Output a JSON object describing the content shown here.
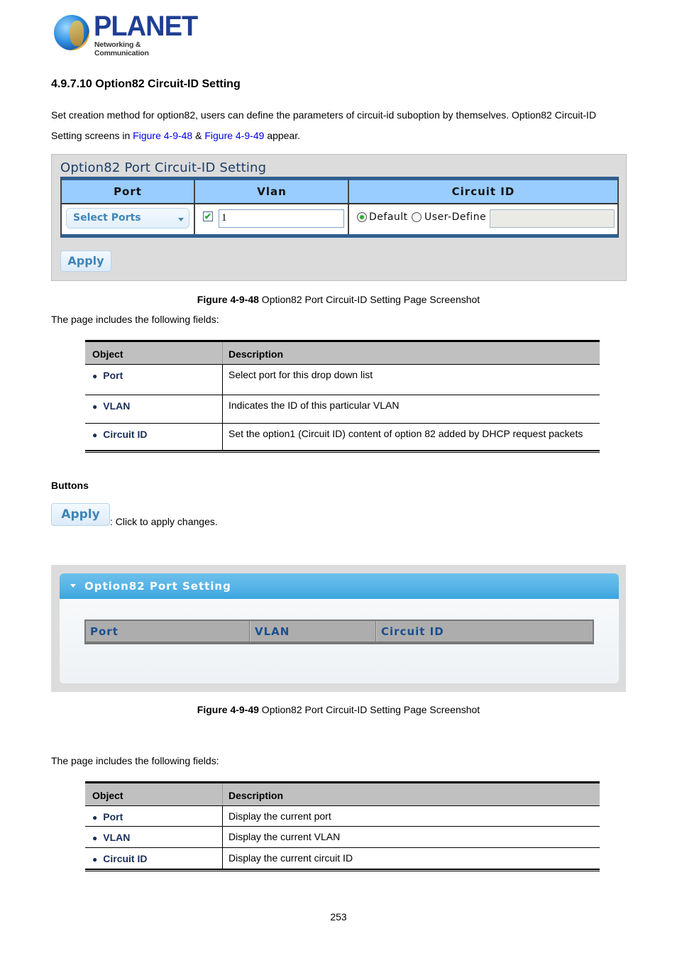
{
  "logo": {
    "brand": "PLANET",
    "tagline": "Networking & Communication"
  },
  "section": {
    "title": "4.9.7.10 Option82 Circuit-ID Setting",
    "intro_line1": "Set creation method for option82, users can define the parameters of circuit-id suboption by themselves. Option82 Circuit-ID",
    "intro_line2_prefix": "Setting screens in ",
    "intro_link1": "Figure 4-9-48",
    "intro_amp": " & ",
    "intro_link2": "Figure 4-9-49",
    "intro_line2_suffix": " appear."
  },
  "figure1": {
    "title": "Option82 Port Circuit-ID Setting",
    "columns": [
      "Port",
      "Vlan",
      "Circuit ID"
    ],
    "port_select": "Select Ports",
    "vlan_checked": true,
    "vlan_value": "1",
    "circuit_options": [
      "Default",
      "User-Define"
    ],
    "circuit_selected": "Default",
    "circuit_value": "",
    "apply_label": "Apply",
    "caption_bold": "Figure 4-9-48",
    "caption_text": " Option82 Port Circuit-ID Setting Page Screenshot"
  },
  "fields_intro_1": "The page includes the following fields:",
  "table1": {
    "headers": [
      "Object",
      "Description"
    ],
    "rows": [
      {
        "object": "Port",
        "description": "Select port for this drop down list"
      },
      {
        "object": "VLAN",
        "description": "Indicates the ID of this particular VLAN"
      },
      {
        "object": "Circuit ID",
        "description": "Set the option1 (Circuit ID) content of option 82 added by DHCP request packets"
      }
    ]
  },
  "buttons_section": {
    "heading": "Buttons",
    "apply_label": "Apply",
    "apply_desc": ": Click to apply changes."
  },
  "figure2": {
    "title": "Option82 Port Setting",
    "columns": [
      "Port",
      "VLAN",
      "Circuit ID"
    ],
    "caption_bold": "Figure 4-9-49",
    "caption_text": " Option82 Port Circuit-ID Setting Page Screenshot"
  },
  "fields_intro_2": "The page includes the following fields:",
  "table2": {
    "headers": [
      "Object",
      "Description"
    ],
    "rows": [
      {
        "object": "Port",
        "description": "Display the current port"
      },
      {
        "object": "VLAN",
        "description": "Display the current VLAN"
      },
      {
        "object": "Circuit ID",
        "description": "Display the current circuit ID"
      }
    ]
  },
  "page_number": "253",
  "colors": {
    "link": "#0000ee",
    "object_text": "#1a2f5a",
    "fig1_header": "#99ccff",
    "fig1_border": "#2f5f8f",
    "fig2_header": "#56b3e6",
    "table_header": "#c0c0c0"
  }
}
